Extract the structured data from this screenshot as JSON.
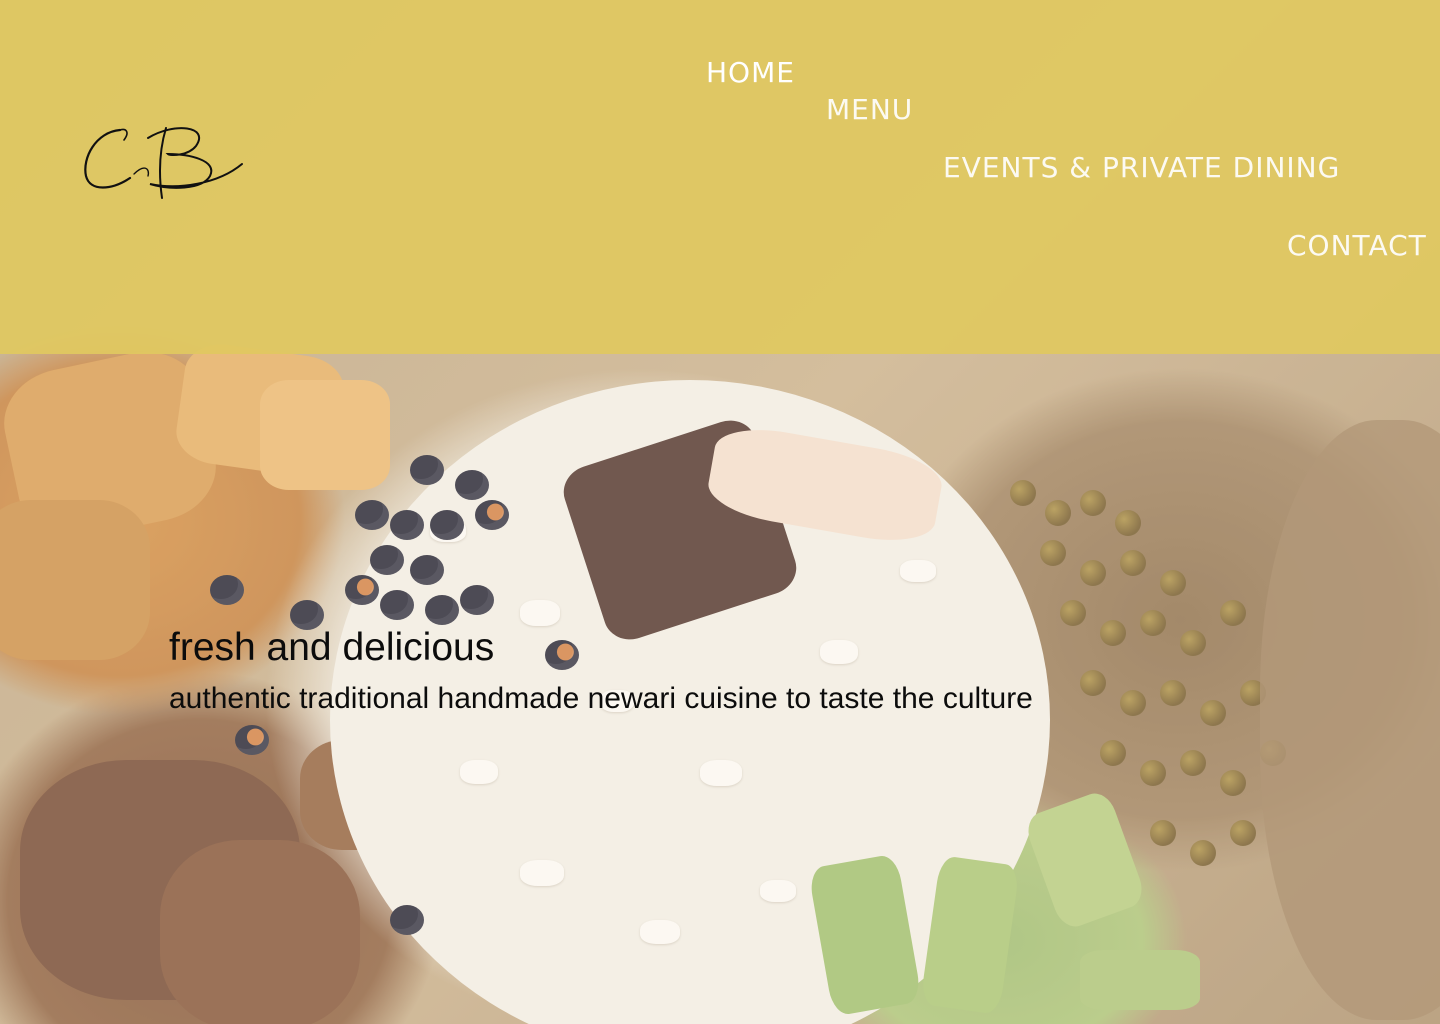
{
  "brand": {
    "logo_text": "CB",
    "logo_icon": "cb-signature-logo-icon"
  },
  "nav": {
    "items": [
      {
        "label": "HOME",
        "active": true
      },
      {
        "label": "MENU",
        "active": false
      },
      {
        "label": "EVENTS & PRIVATE DINING",
        "active": false
      },
      {
        "label": "CONTACT",
        "active": false
      }
    ]
  },
  "hero": {
    "title": "fresh and delicious",
    "subtitle": "authentic traditional handmade newari cuisine to taste the culture",
    "background_image": "newari-food-platter"
  },
  "colors": {
    "header_background": "#e0c860",
    "nav_text": "#ffffff",
    "hero_text": "#0c0c0c"
  }
}
